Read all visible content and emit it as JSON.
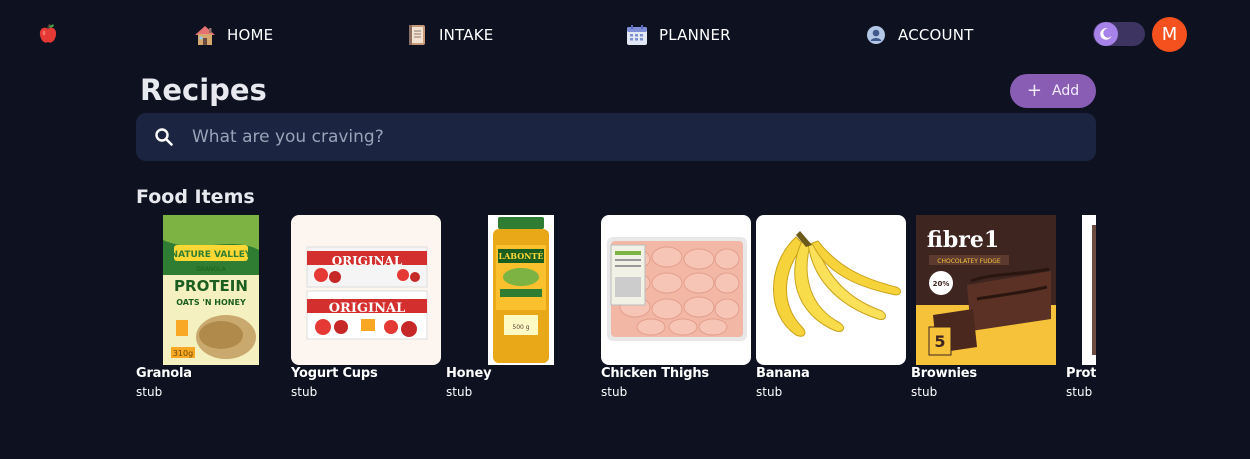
{
  "nav": {
    "logo_icon": "apple-icon",
    "items": [
      {
        "label": "HOME",
        "icon": "house-icon"
      },
      {
        "label": "INTAKE",
        "icon": "notebook-icon"
      },
      {
        "label": "PLANNER",
        "icon": "calendar-icon"
      },
      {
        "label": "ACCOUNT",
        "icon": "user-circle-icon"
      }
    ],
    "theme_toggle_icon": "moon-icon",
    "avatar_initial": "M"
  },
  "page": {
    "title": "Recipes",
    "add_label": "Add"
  },
  "search": {
    "placeholder": "What are you craving?",
    "value": ""
  },
  "food_items": {
    "title": "Food Items",
    "items": [
      {
        "name": "Granola",
        "subtitle": "stub"
      },
      {
        "name": "Yogurt Cups",
        "subtitle": "stub"
      },
      {
        "name": "Honey",
        "subtitle": "stub"
      },
      {
        "name": "Chicken Thighs",
        "subtitle": "stub"
      },
      {
        "name": "Banana",
        "subtitle": "stub"
      },
      {
        "name": "Brownies",
        "subtitle": "stub"
      },
      {
        "name": "Protein",
        "subtitle": "stub"
      }
    ]
  },
  "colors": {
    "background": "#0d1120",
    "search_bg": "#1b2440",
    "accent_purple": "#8a5db5",
    "avatar_orange": "#f4511e"
  }
}
